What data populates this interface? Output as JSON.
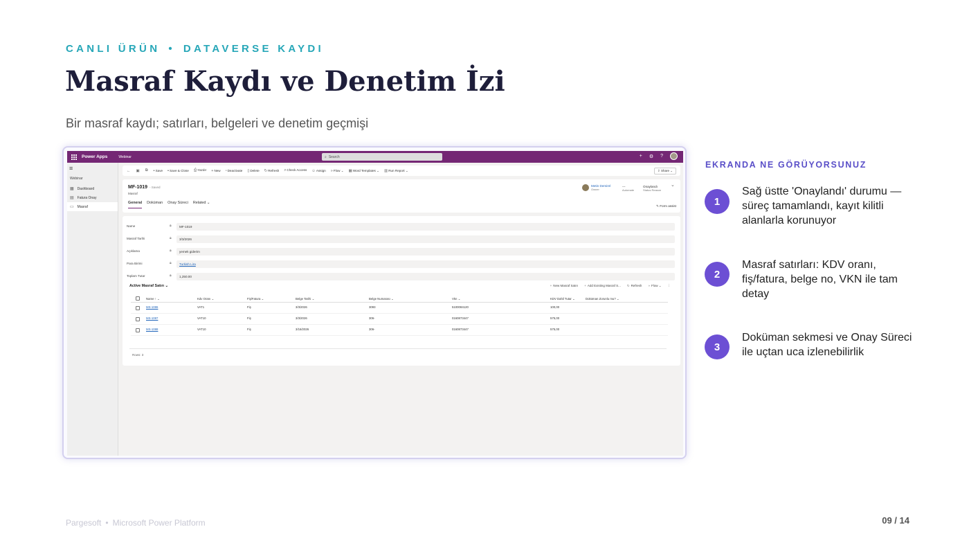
{
  "slide": {
    "kicker_left": "CANLI ÜRÜN",
    "kicker_sep": "•",
    "kicker_right": "DATAVERSE KAYDI",
    "title": "Masraf Kaydı ve Denetim İzi",
    "subtitle": "Bir masraf kaydı; satırları, belgeleri ve denetim geçmişi"
  },
  "app": {
    "brand": "Power Apps",
    "env": "Webinar",
    "search_placeholder": "Search",
    "nav": {
      "area": "Webinar",
      "items": [
        {
          "label": "Dashboard",
          "icon": "dashboard-icon"
        },
        {
          "label": "Fatura Onay",
          "icon": "list-icon"
        },
        {
          "label": "Masraf",
          "icon": "document-icon"
        }
      ]
    },
    "commands": [
      "Save",
      "Save & Close",
      "Yazdır",
      "New",
      "Deactivate",
      "Delete",
      "Refresh",
      "Check Access",
      "Assign",
      "Flow",
      "Word Templates",
      "Run Report"
    ],
    "share": "Share",
    "record": {
      "title": "MF-1019",
      "saved": "- Saved",
      "entity": "Masraf",
      "owner_name": "Metin Demirel",
      "owner_role": "Owner",
      "status_value": "---",
      "status_label": "Automate",
      "status_reason_value": "Onaylandı",
      "status_reason_label": "Status Reason"
    },
    "tabs": [
      "General",
      "Doküman",
      "Onay Süreci",
      "Related"
    ],
    "form_assist": "Form assist",
    "fields": [
      {
        "label": "Name",
        "value": "MF-1019"
      },
      {
        "label": "Masraf Tarihi",
        "value": "3/3/2026"
      },
      {
        "label": "Açıklama",
        "value": "yemek giderim"
      },
      {
        "label": "Para Birimi",
        "value": "Turkish Lira"
      },
      {
        "label": "Toplam Tutar",
        "value": "1,250.00"
      }
    ],
    "subgrid": {
      "title": "Active Masraf Satırı",
      "actions": [
        "New Masraf Satırı",
        "Add Existing Masraf S...",
        "Refresh",
        "Flow"
      ],
      "columns": [
        "Name ↑",
        "Kdv Oranı",
        "Fiş/Fatura",
        "Belge Tarihi",
        "Belge Numarası",
        "Vkn",
        "KDV Dahil Tutar",
        "Doküman Zorunlu mu?"
      ],
      "rows": [
        [
          "MS-1086",
          "VAT1",
          "Fiş",
          "3/3/2026",
          "3093",
          "5100084120",
          "100,00",
          ""
        ],
        [
          "MS-1087",
          "VAT10",
          "Fiş",
          "3/3/2026",
          "306-",
          "0160873447",
          "575,00",
          ""
        ],
        [
          "MS-1088",
          "VAT10",
          "Fiş",
          "3/16/2026",
          "306-",
          "0160873447",
          "575,00",
          ""
        ]
      ],
      "footer": "Rows: 3"
    }
  },
  "panel": {
    "title": "EKRANDA NE GÖRÜYORSUNUZ",
    "points": [
      {
        "num": "1",
        "text": "Sağ üstte 'Onaylandı' durumu — süreç tamamlandı, kayıt kilitli alanlarla korunuyor"
      },
      {
        "num": "2",
        "text": "Masraf satırları: KDV oranı, fiş/fatura, belge no, VKN ile tam detay"
      },
      {
        "num": "3",
        "text": "Doküman sekmesi ve Onay Süreci ile uçtan uca izlenebilirlik"
      }
    ]
  },
  "footer": {
    "company": "Pargesoft",
    "sep": "•",
    "product": "Microsoft Power Platform",
    "page": "09 / 14"
  },
  "colors": {
    "accent_teal": "#27a7b8",
    "accent_purple": "#6c4fd4",
    "app_header": "#742774",
    "title_navy": "#1e1e3a"
  }
}
